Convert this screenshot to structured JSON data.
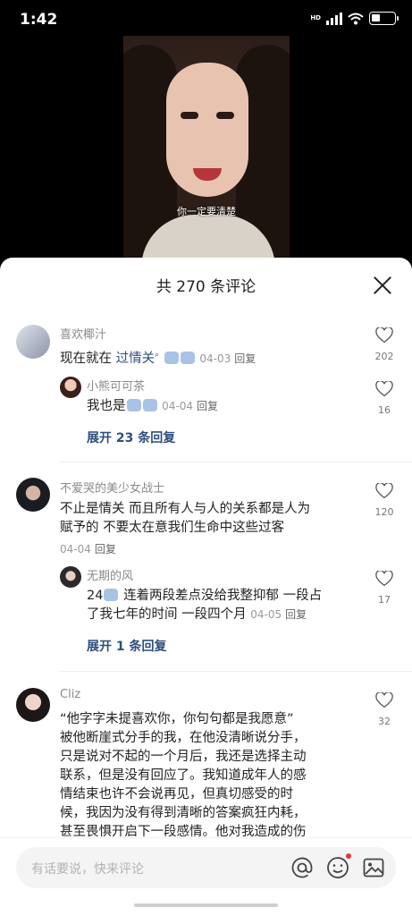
{
  "status": {
    "time": "1:42",
    "network": "HD"
  },
  "video": {
    "subtitle": "你一定要清楚"
  },
  "sheet": {
    "title": "共 270 条评论",
    "close_icon": "close-icon"
  },
  "comments": [
    {
      "user": "喜欢椰汁",
      "text_before": "现在就在 ",
      "text_link": "过情关",
      "date": "04-03",
      "reply": "回复",
      "likes": "202",
      "sub": {
        "user": "小熊可可茶",
        "text": "我也是",
        "date": "04-04",
        "reply": "回复",
        "likes": "16"
      },
      "expand": "展开 23 条回复"
    },
    {
      "user": "不爱哭的美少女战士",
      "line1": "不止是情关 而且所有人与人的关系都是人为",
      "line2": "赋予的 不要太在意我们生命中这些过客",
      "date": "04-04",
      "reply": "回复",
      "likes": "120",
      "sub": {
        "user": "无期的风",
        "line1_prefix": "24",
        "line1": "连着两段差点没给我整抑郁 一段占",
        "line2": "了我七年的时间 一段四个月",
        "date": "04-05",
        "reply": "回复",
        "likes": "17"
      },
      "expand": "展开 1 条回复"
    },
    {
      "user": "Cliz",
      "lines": [
        "“他字字未提喜欢你，你句句都是我愿意”",
        "被他断崖式分手的我，在他没清晰说分手，",
        "只是说对不起的一个月后，我还是选择主动",
        "联系，但是没有回应了。我知道成年人的感",
        "情结束也许不会说再见，但真切感受的时",
        "候，我因为没有得到清晰的答案疯狂内耗，",
        "甚至畏惧开启下一段感情。他对我造成的伤"
      ],
      "likes": "32"
    }
  ],
  "input": {
    "placeholder": "有话要说，快来评论"
  },
  "icons": {
    "heart": "heart-outline-icon",
    "at": "at-icon",
    "emoji": "emoji-icon",
    "image": "image-icon"
  }
}
